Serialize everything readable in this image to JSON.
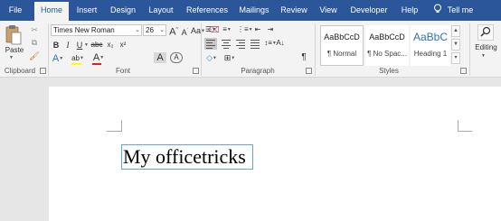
{
  "tabs": [
    {
      "label": "File"
    },
    {
      "label": "Home"
    },
    {
      "label": "Insert"
    },
    {
      "label": "Design"
    },
    {
      "label": "Layout"
    },
    {
      "label": "References"
    },
    {
      "label": "Mailings"
    },
    {
      "label": "Review"
    },
    {
      "label": "View"
    },
    {
      "label": "Developer"
    },
    {
      "label": "Help"
    },
    {
      "label": "Tell me"
    }
  ],
  "clipboard": {
    "paste_label": "Paste",
    "group_label": "Clipboard"
  },
  "font": {
    "font_name": "Times New Roman",
    "font_size": "26",
    "grow_label": "A",
    "shrink_label": "A",
    "case_label": "Aa",
    "bold": "B",
    "italic": "I",
    "underline": "U",
    "strike": "abc",
    "subscript": "x₂",
    "superscript": "x²",
    "effects": "A",
    "highlight": "ab",
    "color_label": "A",
    "shading": "A",
    "enclose": "A",
    "group_label": "Font",
    "highlight_color": "#ffff00",
    "font_color": "#e02020"
  },
  "paragraph": {
    "group_label": "Paragraph",
    "sort_label": "A↓",
    "pilcrow": "¶"
  },
  "styles": {
    "group_label": "Styles",
    "items": [
      {
        "sample": "AaBbCcD",
        "name": "¶ Normal"
      },
      {
        "sample": "AaBbCcD",
        "name": "¶ No Spac..."
      },
      {
        "sample": "AaBbC",
        "name": "Heading 1"
      }
    ]
  },
  "editing": {
    "label": "Editing"
  },
  "document": {
    "text": "My officetricks"
  }
}
